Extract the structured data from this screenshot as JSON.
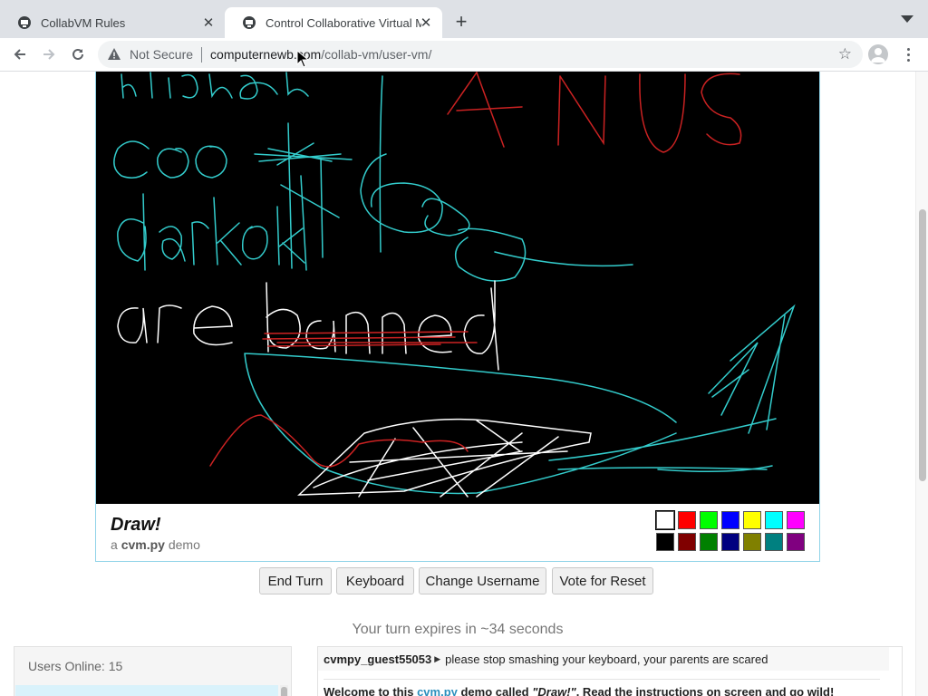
{
  "browser": {
    "tabs": [
      {
        "title": "CollabVM Rules",
        "active": false
      },
      {
        "title": "Control Collaborative Virtual M",
        "active": true
      }
    ],
    "security_label": "Not Secure",
    "url_host": "computernewb.com",
    "url_path": "/collab-vm/user-vm/",
    "icons": {
      "back": "back-arrow-icon",
      "forward": "forward-arrow-icon",
      "reload": "reload-icon",
      "star": "bookmark-star-icon",
      "profile": "profile-icon",
      "menu": "kebab-menu-icon"
    }
  },
  "vm": {
    "title": "Draw!",
    "subtitle_prefix": "a",
    "subtitle_brand": "cvm.py",
    "subtitle_suffix": "demo",
    "palette": {
      "top": [
        "#ffffff",
        "#ff0000",
        "#00ff00",
        "#0000ff",
        "#ffff00",
        "#00ffff",
        "#ff00ff"
      ],
      "bottom": [
        "#000000",
        "#800000",
        "#008000",
        "#000080",
        "#808000",
        "#008080",
        "#800080"
      ]
    },
    "scribble_colors": {
      "cyan": "#33dddd",
      "red": "#cc2222",
      "white": "#ffffff"
    }
  },
  "controls": {
    "end_turn": "End Turn",
    "keyboard": "Keyboard",
    "change_username": "Change Username",
    "vote_reset": "Vote for Reset"
  },
  "turn_status": "Your turn expires in ~34 seconds",
  "users": {
    "title": "Users Online: 15"
  },
  "chat": {
    "messages": [
      {
        "user": "cvmpy_guest55053",
        "text": "please stop smashing your keyboard, your parents are scared"
      }
    ],
    "welcome_prefix": "Welcome to this ",
    "welcome_link": "cvm.py",
    "welcome_mid": " demo called ",
    "welcome_name": "\"Draw!\"",
    "welcome_suffix": ". Read the instructions on screen and go wild!"
  }
}
